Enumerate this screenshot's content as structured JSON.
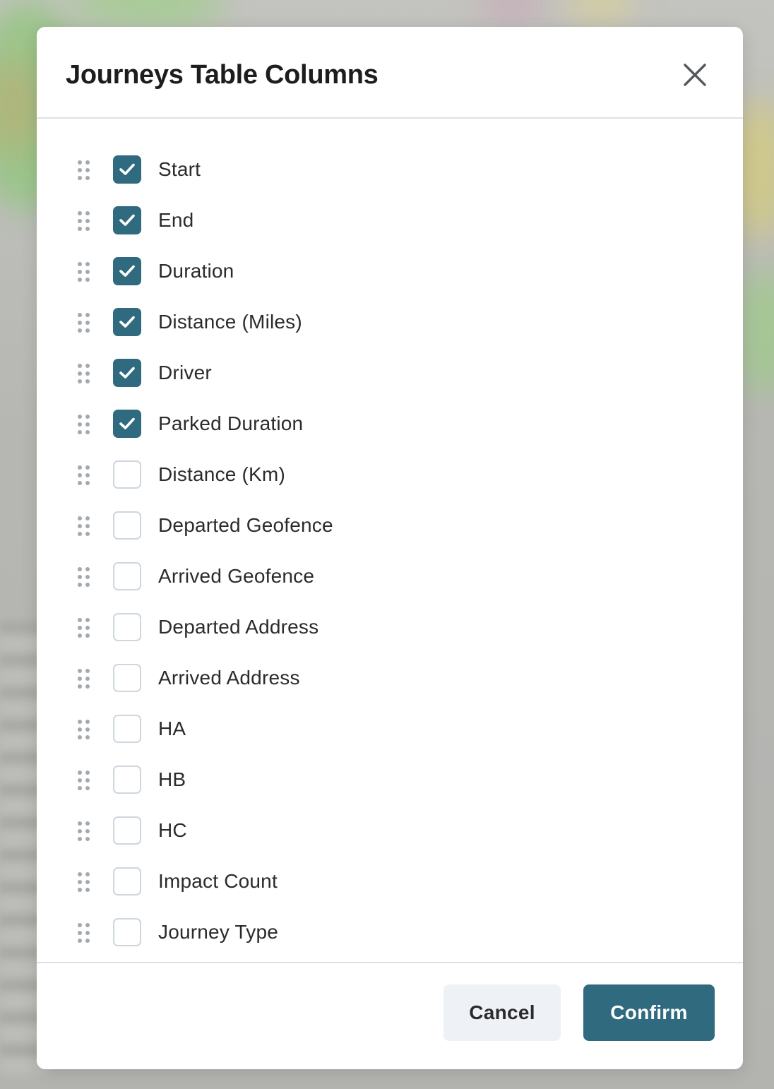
{
  "modal": {
    "title": "Journeys Table Columns",
    "close_icon": "close-icon"
  },
  "columns": [
    {
      "label": "Start",
      "checked": true
    },
    {
      "label": "End",
      "checked": true
    },
    {
      "label": "Duration",
      "checked": true
    },
    {
      "label": "Distance (Miles)",
      "checked": true
    },
    {
      "label": "Driver",
      "checked": true
    },
    {
      "label": "Parked Duration",
      "checked": true
    },
    {
      "label": "Distance (Km)",
      "checked": false
    },
    {
      "label": "Departed Geofence",
      "checked": false
    },
    {
      "label": "Arrived Geofence",
      "checked": false
    },
    {
      "label": "Departed Address",
      "checked": false
    },
    {
      "label": "Arrived Address",
      "checked": false
    },
    {
      "label": "HA",
      "checked": false
    },
    {
      "label": "HB",
      "checked": false
    },
    {
      "label": "HC",
      "checked": false
    },
    {
      "label": "Impact Count",
      "checked": false
    },
    {
      "label": "Journey Type",
      "checked": false
    }
  ],
  "footer": {
    "cancel_label": "Cancel",
    "confirm_label": "Confirm"
  },
  "colors": {
    "accent": "#2f6a7f",
    "checkbox_border": "#ced6de",
    "cancel_bg": "#eef1f5",
    "divider": "#dbe2e8"
  },
  "icons": {
    "drag": "drag-handle-icon",
    "check": "check-icon",
    "close": "close-icon"
  }
}
